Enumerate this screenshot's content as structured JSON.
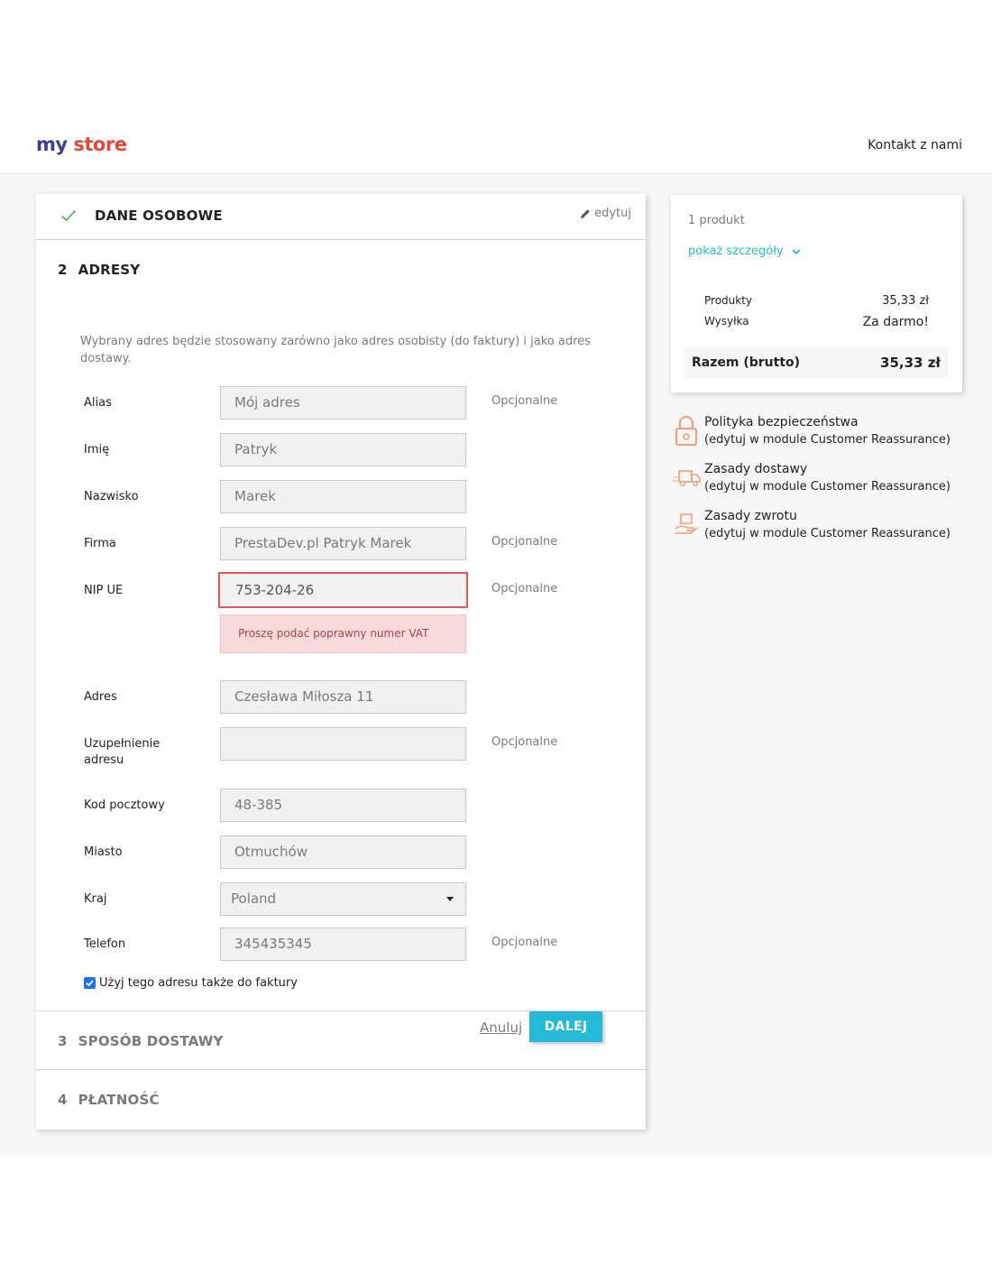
{
  "header": {
    "logo_my": "my",
    "logo_store": "store",
    "contact_link": "Kontakt z nami"
  },
  "steps": {
    "personal": {
      "title": "DANE OSOBOWE",
      "edit_label": "edytuj"
    },
    "addresses": {
      "number": "2",
      "title": "ADRESY",
      "description": "Wybrany adres będzie stosowany zarówno jako adres osobisty (do faktury) i jako adres dostawy.",
      "fields": [
        {
          "label": "Alias",
          "value": "Mój adres",
          "optional": "Opcjonalne"
        },
        {
          "label": "Imię",
          "value": "Patryk",
          "optional": ""
        },
        {
          "label": "Nazwisko",
          "value": "Marek",
          "optional": ""
        },
        {
          "label": "Firma",
          "value": "PrestaDev.pl Patryk Marek",
          "optional": "Opcjonalne"
        },
        {
          "label": "NIP UE",
          "value": "753-204-26",
          "optional": "Opcjonalne"
        },
        {
          "label": "Adres",
          "value": "Czesława Miłosza 11",
          "optional": ""
        },
        {
          "label": "Uzupełnienie adresu",
          "value": "",
          "optional": "Opcjonalne"
        },
        {
          "label": "Kod pocztowy",
          "value": "48-385",
          "optional": ""
        },
        {
          "label": "Miasto",
          "value": "Otmuchów",
          "optional": ""
        },
        {
          "label": "Kraj",
          "value": "Poland",
          "optional": ""
        },
        {
          "label": "Telefon",
          "value": "345435345",
          "optional": "Opcjonalne"
        }
      ],
      "vat_error": "Proszę podać poprawny numer VAT",
      "billing_checkbox": "Użyj tego adresu także do faktury",
      "billing_checked": true,
      "cancel_label": "Anuluj",
      "continue_label": "DALEJ"
    },
    "delivery": {
      "number": "3",
      "title": "SPOSÓB DOSTAWY"
    },
    "payment": {
      "number": "4",
      "title": "PŁATNOŚĆ"
    }
  },
  "cart": {
    "count": "1 produkt",
    "show_details": "pokaż szczegóły",
    "products_label": "Produkty",
    "products_value": "35,33 zł",
    "shipping_label": "Wysyłka",
    "shipping_value": "Za darmo!",
    "total_label": "Razem (brutto)",
    "total_value": "35,33 zł"
  },
  "reassurance": [
    {
      "icon": "lock-icon",
      "title": "Polityka bezpieczeństwa",
      "subtitle": "(edytuj w module Customer Reassurance)"
    },
    {
      "icon": "truck-icon",
      "title": "Zasady dostawy",
      "subtitle": "(edytuj w module Customer Reassurance)"
    },
    {
      "icon": "return-icon",
      "title": "Zasady zwrotu",
      "subtitle": "(edytuj w module Customer Reassurance)"
    }
  ],
  "colors": {
    "accent": "#24b9d7",
    "error_border": "#e1585a",
    "error_bg": "#f8dada",
    "check_green": "#4cbb6c",
    "icon_orange": "#f19d76"
  }
}
